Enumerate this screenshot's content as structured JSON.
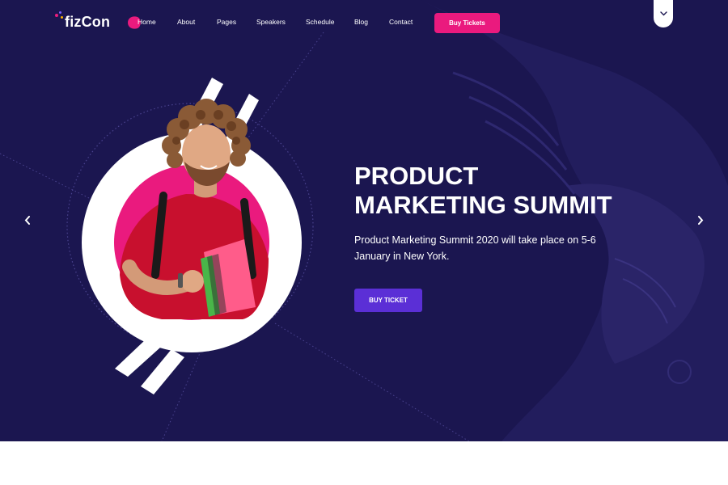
{
  "brand": {
    "logo_text": "fizCon",
    "colors": {
      "primary_bg": "#1b1650",
      "accent_pink": "#ea1a7e",
      "accent_purple": "#5b2fd6"
    }
  },
  "nav": {
    "items": [
      {
        "label": "Home",
        "active": true
      },
      {
        "label": "About"
      },
      {
        "label": "Pages"
      },
      {
        "label": "Speakers"
      },
      {
        "label": "Schedule"
      },
      {
        "label": "Blog"
      },
      {
        "label": "Contact"
      }
    ],
    "cta_label": "Buy Tickets",
    "scroll_icon": "chevron-down-icon"
  },
  "hero": {
    "title_line1": "PRODUCT",
    "title_line2": "MARKETING SUMMIT",
    "description": "Product Marketing Summit 2020 will take place on 5-6 January in New York.",
    "button_label": "BUY TICKET",
    "prev_icon": "chevron-left-icon",
    "next_icon": "chevron-right-icon",
    "image": "student-with-notebooks-photo"
  }
}
